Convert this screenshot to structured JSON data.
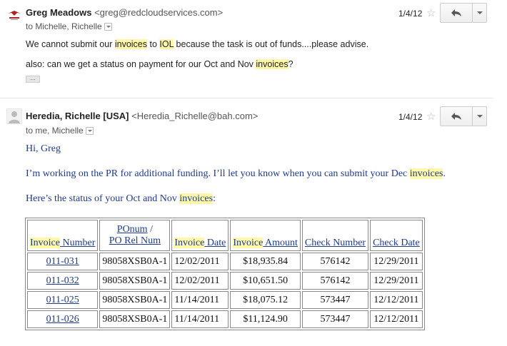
{
  "message1": {
    "sender_name": "Greg Meadows",
    "sender_email": "<greg@redcloudservices.com>",
    "recipients": "to Michelle, Richelle",
    "date": "1/4/12",
    "line1_parts": [
      "We cannot submit our ",
      "invoices",
      " to ",
      "IOL",
      " because the task is out of funds....please advise."
    ],
    "line2_parts": [
      "also: can we get a status on payment for our Oct and Nov ",
      "invoices",
      "?"
    ],
    "ellipsis": "..."
  },
  "message2": {
    "sender_name": "Heredia, Richelle [USA]",
    "sender_email": "<Heredia_Richelle@bah.com>",
    "recipients": "to me, Michelle",
    "date": "1/4/12",
    "greeting": "Hi, Greg",
    "para1_parts": [
      "I’m working on the PR for additional funding. I’ll let you know when you can submit your Dec ",
      "invoices",
      "."
    ],
    "para2_parts": [
      "Here’s the status of your Oct and Nov ",
      "invoices",
      ":"
    ],
    "table": {
      "headers": {
        "invoice_number": [
          "Invoice",
          " Number"
        ],
        "ponum_line1": "POnum",
        "ponum_sep": " /",
        "ponum_line2": "PO Rel Num",
        "invoice_date": [
          "Invoice",
          " Date"
        ],
        "invoice_amount": [
          "Invoice",
          " Amount"
        ],
        "check_number": "Check Number",
        "check_date": "Check Date"
      },
      "rows": [
        {
          "invoice": "011-031",
          "ponum": "98058XSB0A-1",
          "date": "12/02/2011",
          "amount": "$18,935.84",
          "check": "576142",
          "check_date": "12/29/2011"
        },
        {
          "invoice": "011-032",
          "ponum": "98058XSB0A-1",
          "date": "12/02/2011",
          "amount": "$10,651.50",
          "check": "576142",
          "check_date": "12/29/2011"
        },
        {
          "invoice": "011-025",
          "ponum": "98058XSB0A-1",
          "date": "11/14/2011",
          "amount": "$18,075.12",
          "check": "573447",
          "check_date": "12/12/2011"
        },
        {
          "invoice": "011-026",
          "ponum": "98058XSB0A-1",
          "date": "11/14/2011",
          "amount": "$11,124.90",
          "check": "573447",
          "check_date": "12/12/2011"
        }
      ]
    }
  },
  "icons": {
    "star": "☆",
    "star_icon": "star-icon",
    "reply_icon": "reply-icon",
    "more_icon": "chevron-down-icon",
    "avatar_icon": "avatar"
  },
  "colors": {
    "highlight": "#fff8a8",
    "link": "#1f3a8a"
  }
}
